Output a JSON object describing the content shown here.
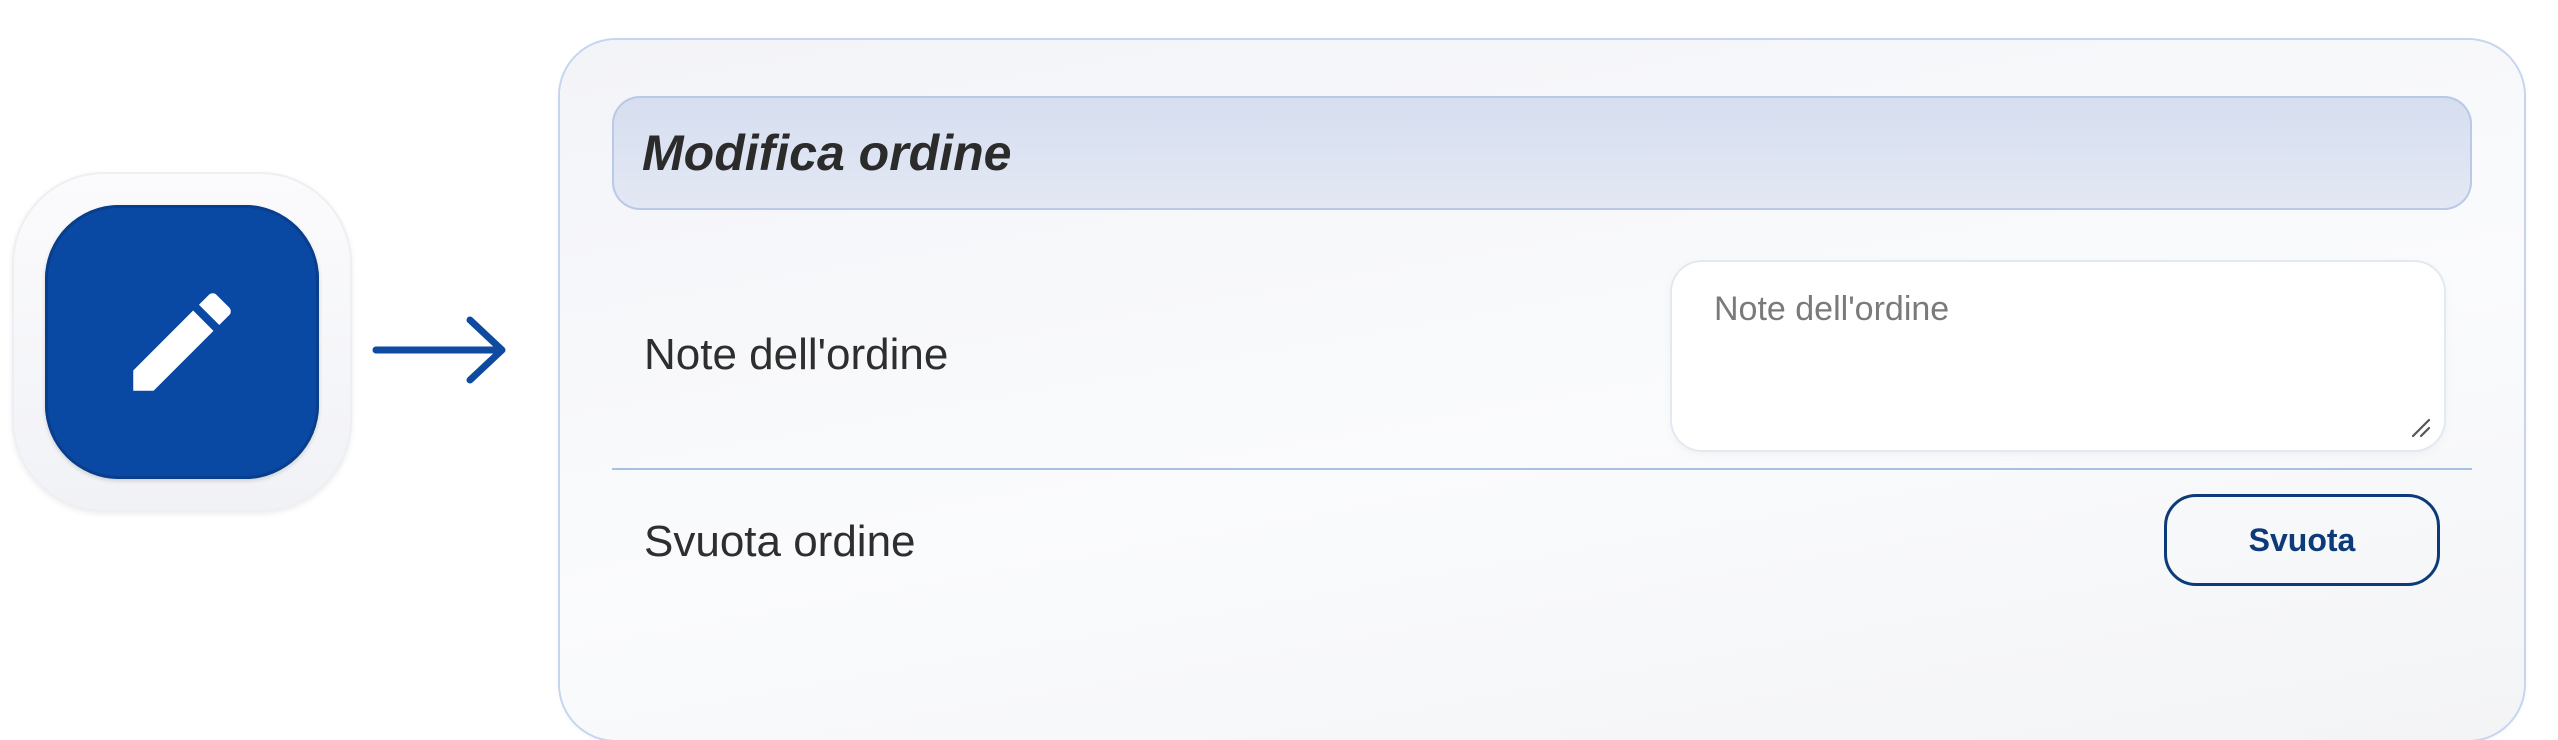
{
  "edit_button": {
    "icon": "pencil-icon",
    "colors": {
      "background": "#0a49a3",
      "icon": "#ffffff"
    }
  },
  "arrow": {
    "icon": "arrow-right-icon",
    "color": "#0d4aa0"
  },
  "panel": {
    "title": "Modifica ordine",
    "notes": {
      "label": "Note dell'ordine",
      "placeholder": "Note dell'ordine",
      "value": ""
    },
    "clear": {
      "label": "Svuota ordine",
      "button_label": "Svuota"
    }
  },
  "colors": {
    "accent": "#0d3a78",
    "header_bg": "#dde4f2",
    "divider": "#a9c0e6"
  }
}
